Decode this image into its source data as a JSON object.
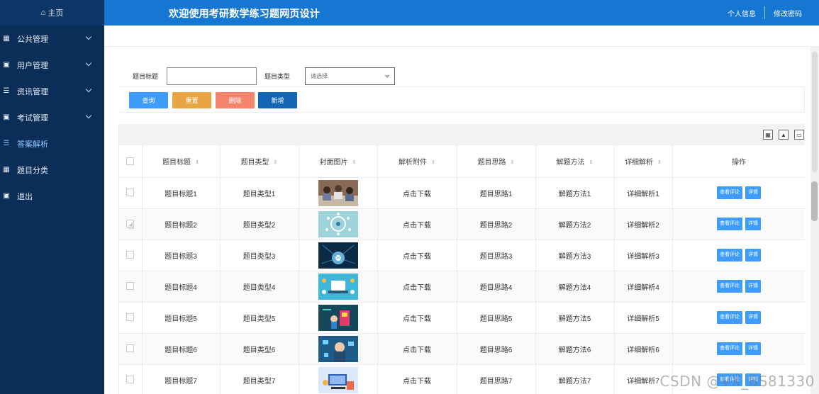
{
  "sidebar": {
    "home_label": "主页",
    "items": [
      {
        "label": "公共管理",
        "icon": "grid-icon",
        "has_chevron": true
      },
      {
        "label": "用户管理",
        "icon": "book-icon",
        "has_chevron": true
      },
      {
        "label": "资讯管理",
        "icon": "list-icon",
        "has_chevron": true
      },
      {
        "label": "考试管理",
        "icon": "book-icon",
        "has_chevron": true
      },
      {
        "label": "答案解析",
        "icon": "list-icon",
        "has_chevron": false,
        "active": true
      },
      {
        "label": "题目分类",
        "icon": "grid-icon",
        "has_chevron": false
      },
      {
        "label": "退出",
        "icon": "book-icon",
        "has_chevron": false
      }
    ]
  },
  "header": {
    "title": "欢迎使用考研数学练习题网页设计",
    "profile_link": "个人信息",
    "password_link": "修改密码"
  },
  "search": {
    "title_label": "题目标题",
    "title_value": "",
    "type_label": "题目类型",
    "type_placeholder": "请选择"
  },
  "buttons": {
    "query": "查询",
    "reset": "重置",
    "delete": "删除",
    "add": "新增"
  },
  "toolbar_icons": [
    "columns-icon",
    "export-icon",
    "print-icon"
  ],
  "table": {
    "columns": [
      "题目标题",
      "题目类型",
      "封面图片",
      "解析附件",
      "题目思路",
      "解题方法",
      "详细解析",
      "操作"
    ],
    "rows": [
      {
        "title": "题目标题1",
        "type": "题目类型1",
        "attachment": "点击下载",
        "idea": "题目思路1",
        "method": "解题方法1",
        "detail": "详细解析1"
      },
      {
        "title": "题目标题2",
        "type": "题目类型2",
        "attachment": "点击下载",
        "idea": "题目思路2",
        "method": "解题方法2",
        "detail": "详细解析2"
      },
      {
        "title": "题目标题3",
        "type": "题目类型3",
        "attachment": "点击下载",
        "idea": "题目思路3",
        "method": "解题方法3",
        "detail": "详细解析3"
      },
      {
        "title": "题目标题4",
        "type": "题目类型4",
        "attachment": "点击下载",
        "idea": "题目思路4",
        "method": "解题方法4",
        "detail": "详细解析4"
      },
      {
        "title": "题目标题5",
        "type": "题目类型5",
        "attachment": "点击下载",
        "idea": "题目思路5",
        "method": "解题方法5",
        "detail": "详细解析5"
      },
      {
        "title": "题目标题6",
        "type": "题目类型6",
        "attachment": "点击下载",
        "idea": "题目思路6",
        "method": "解题方法6",
        "detail": "详细解析6"
      },
      {
        "title": "题目标题7",
        "type": "题目类型7",
        "attachment": "点击下载",
        "idea": "题目思路7",
        "method": "解题方法7",
        "detail": "详细解析7"
      }
    ],
    "op_view_comments": "查看评论",
    "op_detail": "详情"
  },
  "watermark": "CSDN @VX_BS81330",
  "colors": {
    "sidebar_bg": "#0b2e59",
    "header_bg": "#1677d2",
    "primary": "#3e9dfa",
    "reset": "#e8a543",
    "delete": "#f5846d",
    "add": "#1366b4"
  }
}
